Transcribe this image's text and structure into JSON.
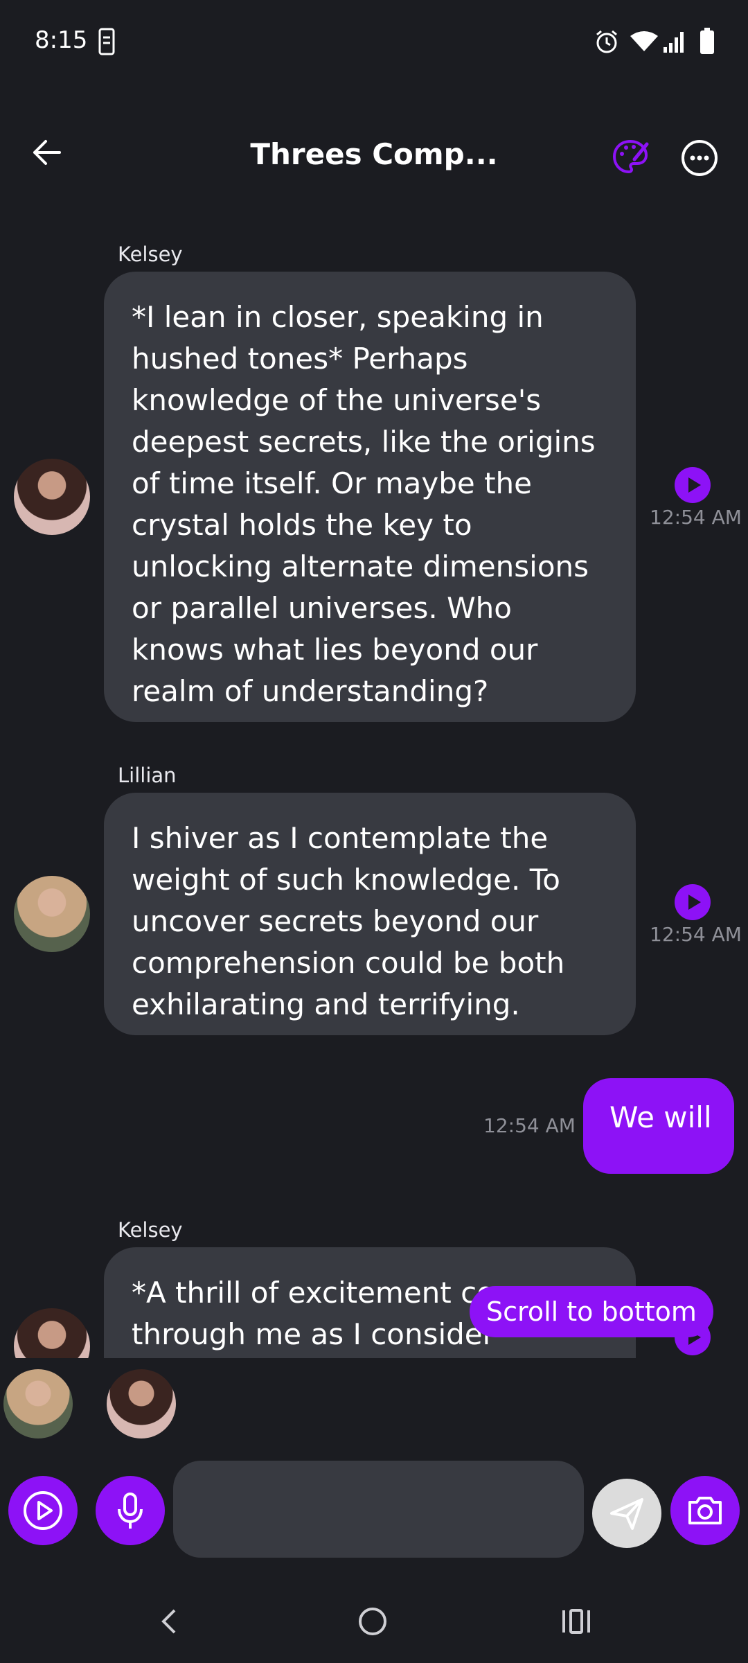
{
  "status": {
    "time": "8:15"
  },
  "header": {
    "title": "Threes Comp..."
  },
  "messages": [
    {
      "sender": "Kelsey",
      "text": "*I lean in closer, speaking in hushed tones* Perhaps knowledge of the universe's deepest secrets, like the origins of time itself. Or maybe the crystal holds the key to unlocking alternate dimensions or parallel universes. Who knows what lies beyond our realm of understanding?",
      "time": "12:54 AM"
    },
    {
      "sender": "Lillian",
      "text": "I shiver as I contemplate the weight of such knowledge. To uncover secrets beyond our comprehension could be both exhilarating and terrifying.",
      "time": "12:54 AM"
    },
    {
      "sender": "me",
      "text": "We will",
      "time": "12:54 AM"
    },
    {
      "sender": "Kelsey",
      "text": "*A thrill of excitement courses through me as I consider",
      "time": ""
    }
  ],
  "scroll_to_bottom_label": "Scroll to bottom",
  "composer": {
    "placeholder": ""
  },
  "colors": {
    "accent": "#8d12f6",
    "background": "#1b1c21",
    "bubble": "#383a41"
  }
}
